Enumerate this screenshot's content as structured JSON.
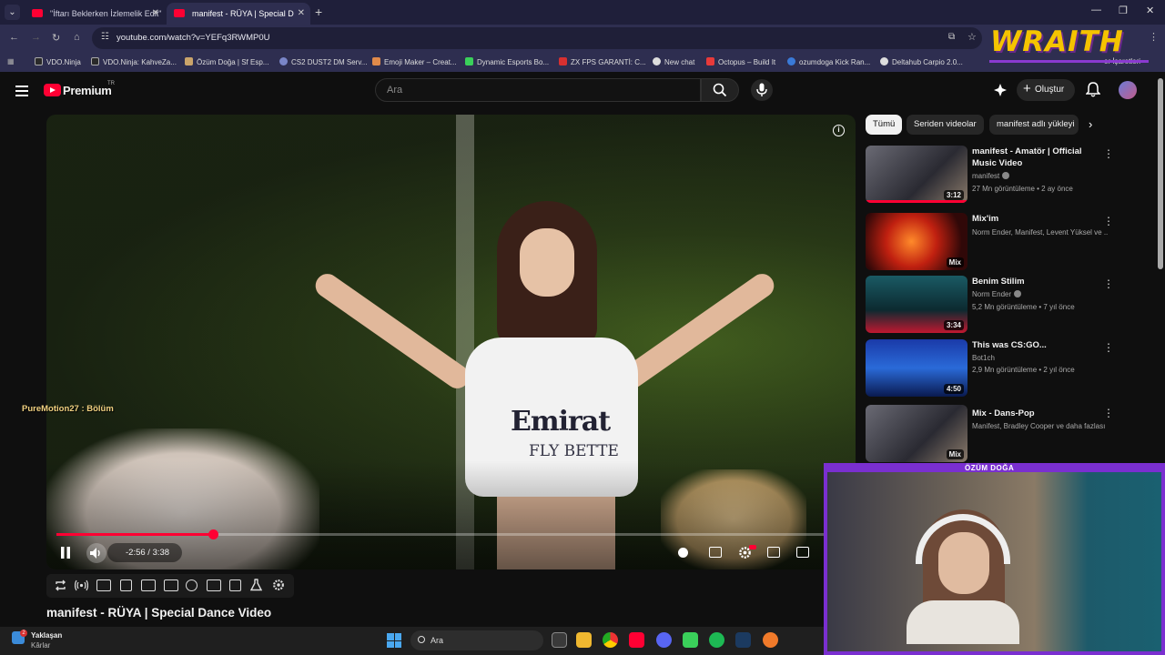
{
  "browser": {
    "tabs": [
      {
        "title": "\"İftarı Beklerken İzlemelik Edit\"",
        "active": false
      },
      {
        "title": "manifest - RÜYA | Special D",
        "active": true
      }
    ],
    "url": "youtube.com/watch?v=YEFq3RWMP0U",
    "bookmarks": [
      "VDO.Ninja",
      "VDO.Ninja: KahveZa...",
      "Özüm Doğa | Sf Esp...",
      "CS2 DUST2 DM Serv...",
      "Emoji Maker – Creat...",
      "Dynamic Esports Bo...",
      "ZX FPS GARANTİ: C...",
      "New chat",
      "Octopus – Build It",
      "ozumdoga Kick Ran...",
      "Deltahub Carpio 2.0...",
      "er İşaretleri"
    ],
    "overlay_brand": "WRAITH"
  },
  "header": {
    "logo_text": "Premium",
    "region_code": "TR",
    "search_placeholder": "Ara",
    "create_label": "Oluştur"
  },
  "player": {
    "elapsed_fraction": 0.2,
    "time_display": "-2:56 / 3:38",
    "overlay_label": "PureMotion27 : Bölüm",
    "shirt_text_1": "Emirat",
    "shirt_text_2": "FLY BETTE"
  },
  "video": {
    "title": "manifest - RÜYA | Special Dance Video"
  },
  "chips": [
    {
      "label": "Tümü",
      "active": true
    },
    {
      "label": "Seriden videolar",
      "active": false
    },
    {
      "label": "manifest adlı yükleyi",
      "active": false
    }
  ],
  "recommendations": [
    {
      "title": "manifest - Amatör | Official Music Video",
      "channel": "manifest",
      "verified": true,
      "meta": "27 Mn görüntüleme • 2 ay önce",
      "duration": "3:12",
      "watched": true
    },
    {
      "title": "Mix'im",
      "channel": "Norm Ender, Manifest, Levent Yüksel ve ...",
      "verified": false,
      "meta": "",
      "duration": "Mix",
      "watched": false
    },
    {
      "title": "Benim Stilim",
      "channel": "Norm Ender",
      "verified": true,
      "meta": "5,2 Mn görüntüleme • 7 yıl önce",
      "duration": "3:34",
      "watched": false
    },
    {
      "title": "This was CS:GO...",
      "channel": "Bot1ch",
      "verified": false,
      "meta": "2,9 Mn görüntüleme • 2 yıl önce",
      "duration": "4:50",
      "watched": false
    },
    {
      "title": "Mix - Dans-Pop",
      "channel": "Manifest, Bradley Cooper ve daha fazlası",
      "verified": false,
      "meta": "",
      "duration": "Mix",
      "watched": false
    }
  ],
  "webcam": {
    "label": "ÖZÜM DOĞA"
  },
  "taskbar": {
    "weather_title": "Yaklaşan",
    "weather_sub": "Kârlar",
    "search_label": "Ara",
    "badge": "2"
  },
  "colors": {
    "accent": "#ff0033",
    "brand_overlay": "#f5c400",
    "webcam_frame": "#7a2fd0"
  }
}
